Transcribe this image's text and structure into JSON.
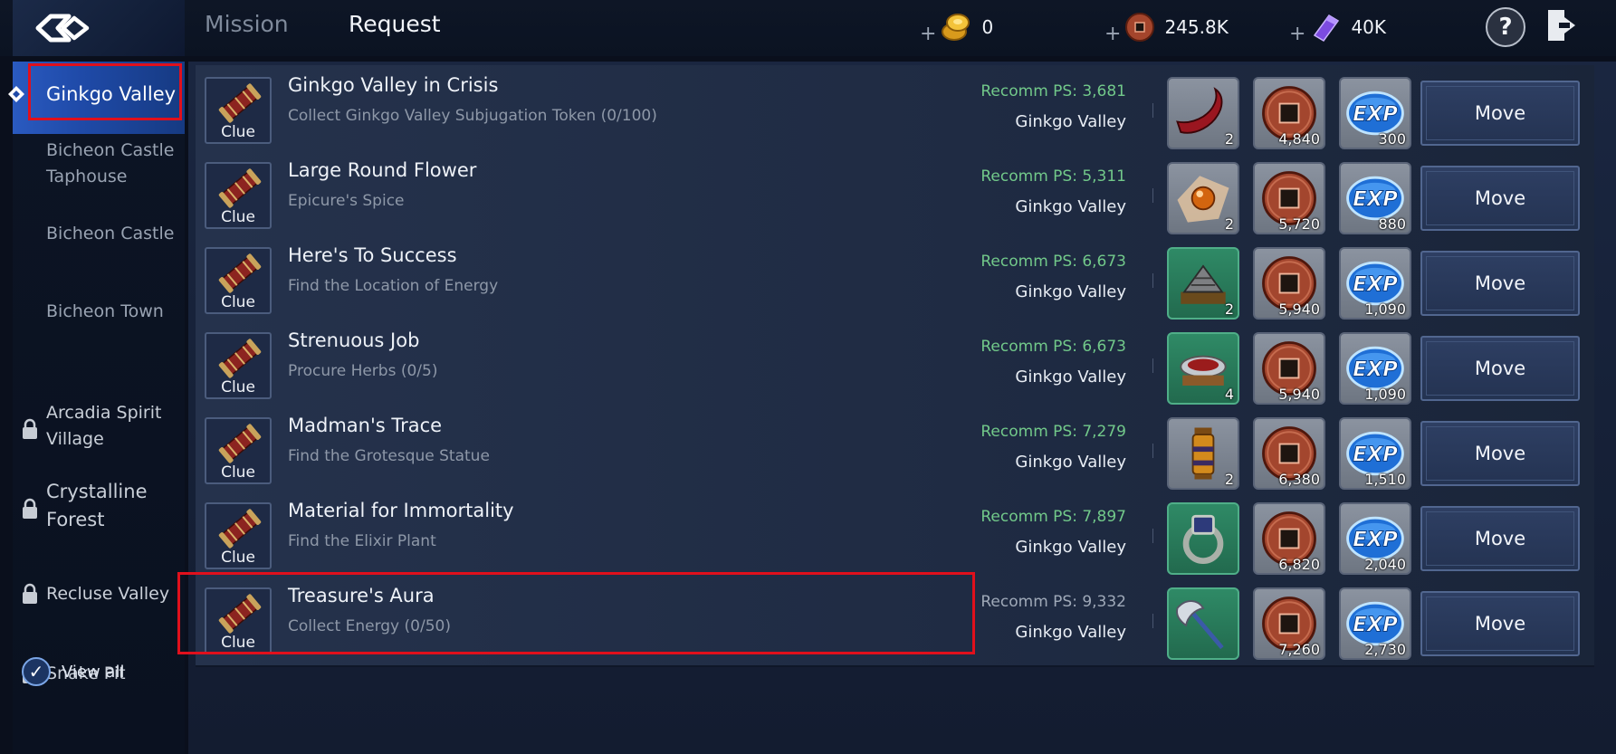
{
  "tabs": {
    "mission": "Mission",
    "request": "Request"
  },
  "currency": [
    {
      "plus": "+",
      "icon": "gold-ingot-icon",
      "value": "0"
    },
    {
      "plus": "+",
      "icon": "copper-coin-icon",
      "value": "245.8K"
    },
    {
      "plus": "+",
      "icon": "purple-crystal-icon",
      "value": "40K"
    }
  ],
  "help_label": "?",
  "sidebar": {
    "items": [
      {
        "label": "Ginkgo Valley",
        "locked": false,
        "active": true
      },
      {
        "label": "Bicheon Castle Taphouse",
        "locked": false
      },
      {
        "label": "Bicheon Castle",
        "locked": false
      },
      {
        "label": "Bicheon Town",
        "locked": false
      },
      {
        "label": "Arcadia Spirit Village",
        "locked": true
      },
      {
        "label": "Crystalline Forest",
        "locked": true
      },
      {
        "label": "Recluse Valley",
        "locked": true
      },
      {
        "label": "Snake Pit",
        "locked": true
      }
    ],
    "view_all": "View all",
    "view_all_checked": true
  },
  "requests": [
    {
      "clue": "Clue",
      "title": "Ginkgo Valley in Crisis",
      "subtitle": "Collect Ginkgo Valley Subjugation Token (0/100)",
      "ps": "Recomm PS: 3,681",
      "area": "Ginkgo Valley",
      "rewards": [
        {
          "icon": "red-horn-icon",
          "qty": "2"
        },
        {
          "icon": "copper-coin-icon",
          "qty": "4,840"
        },
        {
          "icon": "exp-icon",
          "qty": "300"
        }
      ],
      "move": "Move"
    },
    {
      "clue": "Clue",
      "title": "Large Round Flower",
      "subtitle": "Epicure's Spice",
      "ps": "Recomm PS: 5,311",
      "area": "Ginkgo Valley",
      "rewards": [
        {
          "icon": "orange-orb-icon",
          "qty": "2"
        },
        {
          "icon": "copper-coin-icon",
          "qty": "5,720"
        },
        {
          "icon": "exp-icon",
          "qty": "880"
        }
      ],
      "move": "Move"
    },
    {
      "clue": "Clue",
      "title": "Here's To Success",
      "subtitle": "Find the Location of Energy",
      "ps": "Recomm PS: 6,673",
      "area": "Ginkgo Valley",
      "rewards": [
        {
          "icon": "armor-chest-icon",
          "qty": "2"
        },
        {
          "icon": "copper-coin-icon",
          "qty": "5,940"
        },
        {
          "icon": "exp-icon",
          "qty": "1,090"
        }
      ],
      "move": "Move"
    },
    {
      "clue": "Clue",
      "title": "Strenuous Job",
      "subtitle": "Procure Herbs (0/5)",
      "ps": "Recomm PS: 6,673",
      "area": "Ginkgo Valley",
      "rewards": [
        {
          "icon": "herb-bowl-icon",
          "qty": "4"
        },
        {
          "icon": "copper-coin-icon",
          "qty": "5,940"
        },
        {
          "icon": "exp-icon",
          "qty": "1,090"
        }
      ],
      "move": "Move"
    },
    {
      "clue": "Clue",
      "title": "Madman's Trace",
      "subtitle": "Find the Grotesque Statue",
      "ps": "Recomm PS: 7,279",
      "area": "Ginkgo Valley",
      "rewards": [
        {
          "icon": "lantern-icon",
          "qty": "2"
        },
        {
          "icon": "copper-coin-icon",
          "qty": "6,380"
        },
        {
          "icon": "exp-icon",
          "qty": "1,510"
        }
      ],
      "move": "Move"
    },
    {
      "clue": "Clue",
      "title": "Material for Immortality",
      "subtitle": "Find the Elixir Plant",
      "ps": "Recomm PS: 7,897",
      "area": "Ginkgo Valley",
      "rewards": [
        {
          "icon": "ring-icon",
          "qty": ""
        },
        {
          "icon": "copper-coin-icon",
          "qty": "6,820"
        },
        {
          "icon": "exp-icon",
          "qty": "2,040"
        }
      ],
      "move": "Move"
    },
    {
      "clue": "Clue",
      "title": "Treasure's Aura",
      "subtitle": "Collect Energy (0/50)",
      "ps": "Recomm PS: 9,332",
      "area": "Ginkgo Valley",
      "rewards": [
        {
          "icon": "halberd-icon",
          "qty": ""
        },
        {
          "icon": "copper-coin-icon",
          "qty": "7,260"
        },
        {
          "icon": "exp-icon",
          "qty": "2,730"
        }
      ],
      "move": "Move"
    }
  ],
  "colors": {
    "accent": "#1f4aa8",
    "highlight": "#e0101c",
    "ps_text": "#72c98a"
  }
}
